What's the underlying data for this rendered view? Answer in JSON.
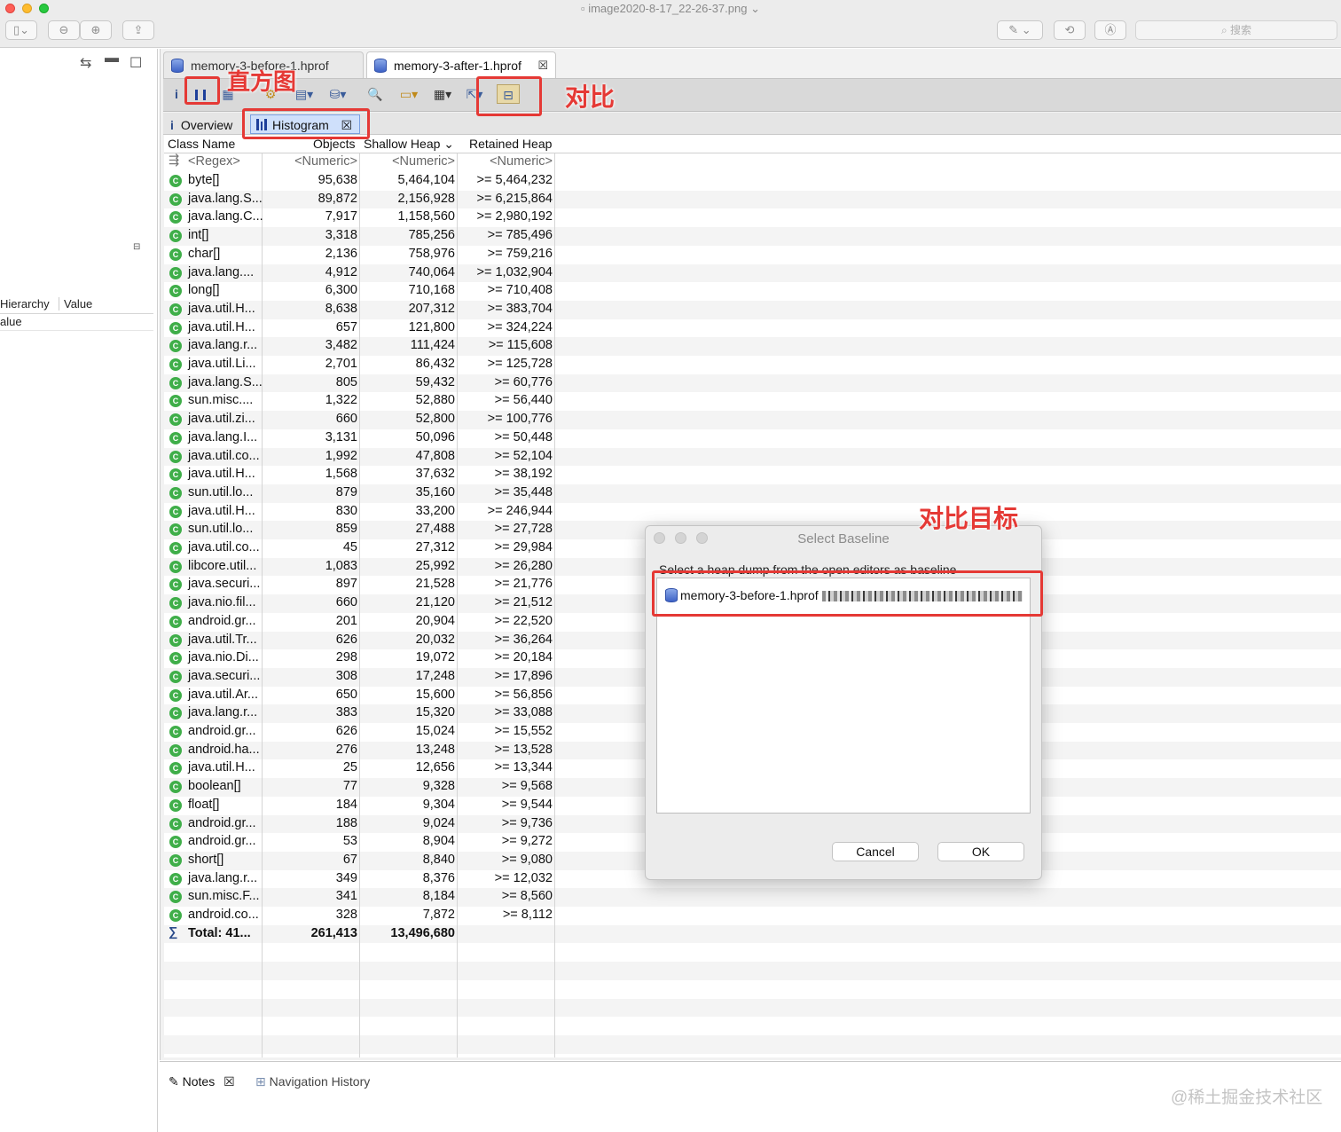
{
  "window": {
    "title": "image2020-8-17_22-26-37.png",
    "search_placeholder": "搜索"
  },
  "left_pane": {
    "columns": [
      "Hierarchy",
      "Value"
    ],
    "row_label": "alue"
  },
  "editor_tabs": [
    {
      "label": "memory-3-before-1.hprof",
      "active": false
    },
    {
      "label": "memory-3-after-1.hprof",
      "active": true
    }
  ],
  "subtabs": {
    "overview": "Overview",
    "histogram": "Histogram"
  },
  "table": {
    "headers": {
      "class_name": "Class Name",
      "objects": "Objects",
      "shallow": "Shallow Heap",
      "retained": "Retained Heap"
    },
    "filter": {
      "name": "<Regex>",
      "objects": "<Numeric>",
      "shallow": "<Numeric>",
      "retained": "<Numeric>"
    },
    "rows": [
      {
        "name": "byte[]",
        "objects": "95,638",
        "shallow": "5,464,104",
        "retained": ">= 5,464,232"
      },
      {
        "name": "java.lang.S...",
        "objects": "89,872",
        "shallow": "2,156,928",
        "retained": ">= 6,215,864"
      },
      {
        "name": "java.lang.C...",
        "objects": "7,917",
        "shallow": "1,158,560",
        "retained": ">= 2,980,192"
      },
      {
        "name": "int[]",
        "objects": "3,318",
        "shallow": "785,256",
        "retained": ">= 785,496"
      },
      {
        "name": "char[]",
        "objects": "2,136",
        "shallow": "758,976",
        "retained": ">= 759,216"
      },
      {
        "name": "java.lang....",
        "objects": "4,912",
        "shallow": "740,064",
        "retained": ">= 1,032,904"
      },
      {
        "name": "long[]",
        "objects": "6,300",
        "shallow": "710,168",
        "retained": ">= 710,408"
      },
      {
        "name": "java.util.H...",
        "objects": "8,638",
        "shallow": "207,312",
        "retained": ">= 383,704"
      },
      {
        "name": "java.util.H...",
        "objects": "657",
        "shallow": "121,800",
        "retained": ">= 324,224"
      },
      {
        "name": "java.lang.r...",
        "objects": "3,482",
        "shallow": "111,424",
        "retained": ">= 115,608"
      },
      {
        "name": "java.util.Li...",
        "objects": "2,701",
        "shallow": "86,432",
        "retained": ">= 125,728"
      },
      {
        "name": "java.lang.S...",
        "objects": "805",
        "shallow": "59,432",
        "retained": ">= 60,776"
      },
      {
        "name": "sun.misc....",
        "objects": "1,322",
        "shallow": "52,880",
        "retained": ">= 56,440"
      },
      {
        "name": "java.util.zi...",
        "objects": "660",
        "shallow": "52,800",
        "retained": ">= 100,776"
      },
      {
        "name": "java.lang.I...",
        "objects": "3,131",
        "shallow": "50,096",
        "retained": ">= 50,448"
      },
      {
        "name": "java.util.co...",
        "objects": "1,992",
        "shallow": "47,808",
        "retained": ">= 52,104"
      },
      {
        "name": "java.util.H...",
        "objects": "1,568",
        "shallow": "37,632",
        "retained": ">= 38,192"
      },
      {
        "name": "sun.util.lo...",
        "objects": "879",
        "shallow": "35,160",
        "retained": ">= 35,448"
      },
      {
        "name": "java.util.H...",
        "objects": "830",
        "shallow": "33,200",
        "retained": ">= 246,944"
      },
      {
        "name": "sun.util.lo...",
        "objects": "859",
        "shallow": "27,488",
        "retained": ">= 27,728"
      },
      {
        "name": "java.util.co...",
        "objects": "45",
        "shallow": "27,312",
        "retained": ">= 29,984"
      },
      {
        "name": "libcore.util...",
        "objects": "1,083",
        "shallow": "25,992",
        "retained": ">= 26,280"
      },
      {
        "name": "java.securi...",
        "objects": "897",
        "shallow": "21,528",
        "retained": ">= 21,776"
      },
      {
        "name": "java.nio.fil...",
        "objects": "660",
        "shallow": "21,120",
        "retained": ">= 21,512"
      },
      {
        "name": "android.gr...",
        "objects": "201",
        "shallow": "20,904",
        "retained": ">= 22,520"
      },
      {
        "name": "java.util.Tr...",
        "objects": "626",
        "shallow": "20,032",
        "retained": ">= 36,264"
      },
      {
        "name": "java.nio.Di...",
        "objects": "298",
        "shallow": "19,072",
        "retained": ">= 20,184"
      },
      {
        "name": "java.securi...",
        "objects": "308",
        "shallow": "17,248",
        "retained": ">= 17,896"
      },
      {
        "name": "java.util.Ar...",
        "objects": "650",
        "shallow": "15,600",
        "retained": ">= 56,856"
      },
      {
        "name": "java.lang.r...",
        "objects": "383",
        "shallow": "15,320",
        "retained": ">= 33,088"
      },
      {
        "name": "android.gr...",
        "objects": "626",
        "shallow": "15,024",
        "retained": ">= 15,552"
      },
      {
        "name": "android.ha...",
        "objects": "276",
        "shallow": "13,248",
        "retained": ">= 13,528"
      },
      {
        "name": "java.util.H...",
        "objects": "25",
        "shallow": "12,656",
        "retained": ">= 13,344"
      },
      {
        "name": "boolean[]",
        "objects": "77",
        "shallow": "9,328",
        "retained": ">= 9,568"
      },
      {
        "name": "float[]",
        "objects": "184",
        "shallow": "9,304",
        "retained": ">= 9,544"
      },
      {
        "name": "android.gr...",
        "objects": "188",
        "shallow": "9,024",
        "retained": ">= 9,736"
      },
      {
        "name": "android.gr...",
        "objects": "53",
        "shallow": "8,904",
        "retained": ">= 9,272"
      },
      {
        "name": "short[]",
        "objects": "67",
        "shallow": "8,840",
        "retained": ">= 9,080"
      },
      {
        "name": "java.lang.r...",
        "objects": "349",
        "shallow": "8,376",
        "retained": ">= 12,032"
      },
      {
        "name": "sun.misc.F...",
        "objects": "341",
        "shallow": "8,184",
        "retained": ">= 8,560"
      },
      {
        "name": "android.co...",
        "objects": "328",
        "shallow": "7,872",
        "retained": ">= 8,112"
      }
    ],
    "total": {
      "name": "Total: 41...",
      "objects": "261,413",
      "shallow": "13,496,680",
      "retained": ""
    }
  },
  "dialog": {
    "title": "Select Baseline",
    "instruction": "Select a heap dump from the open editors as baseline",
    "item": "memory-3-before-1.hprof",
    "cancel": "Cancel",
    "ok": "OK"
  },
  "bottom_tabs": {
    "notes": "Notes",
    "navigation": "Navigation History"
  },
  "annotations": {
    "histogram": "直方图",
    "compare": "对比",
    "compare_target": "对比目标",
    "color": "#e53935"
  },
  "watermark": "@稀土掘金技术社区"
}
